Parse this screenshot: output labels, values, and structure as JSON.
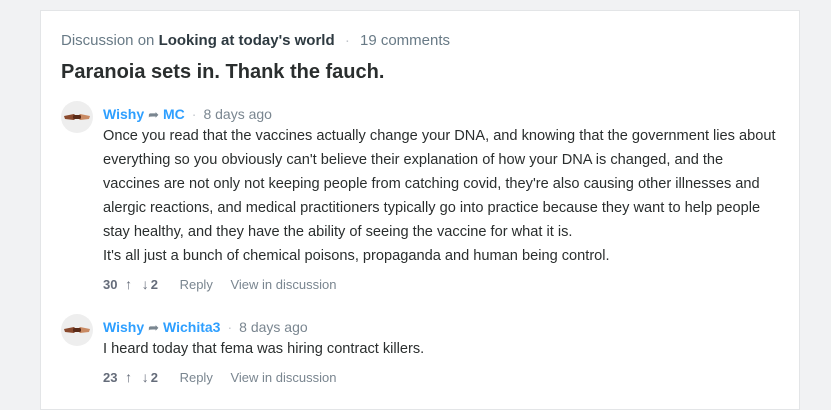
{
  "discussion": {
    "prefix": "Discussion on",
    "thread_title": "Looking at today's world",
    "comment_count": "19 comments",
    "post_title": "Paranoia sets in. Thank the fauch."
  },
  "comments": [
    {
      "author": "Wishy",
      "reply_to": "MC",
      "time": "8 days ago",
      "paragraphs": [
        "Once you read that the vaccines actually change your DNA, and knowing that the government lies about everything so you obviously can't believe their explanation of how your DNA is changed, and the vaccines are not only not keeping people from catching covid, they're also causing other illnesses and alergic reactions, and medical practitioners typically go into practice because they want to help people stay healthy, and they have the ability of seeing the vaccine for what it is.",
        "It's all just a bunch of chemical poisons, propaganda and human being control."
      ],
      "upvotes": "30",
      "downvotes": "2",
      "reply_label": "Reply",
      "view_label": "View in discussion"
    },
    {
      "author": "Wishy",
      "reply_to": "Wichita3",
      "time": "8 days ago",
      "paragraphs": [
        "I heard today that fema was hiring contract killers."
      ],
      "upvotes": "23",
      "downvotes": "2",
      "reply_label": "Reply",
      "view_label": "View in discussion"
    }
  ],
  "icons": {
    "reply_arrow": "reply-arrow-icon",
    "upvote": "arrow-up-icon",
    "downvote": "arrow-down-icon",
    "avatar": "avatar-handshake-icon"
  },
  "colors": {
    "link_blue": "#2e9fff",
    "muted": "#7a8690",
    "text": "#2a2e2e"
  }
}
